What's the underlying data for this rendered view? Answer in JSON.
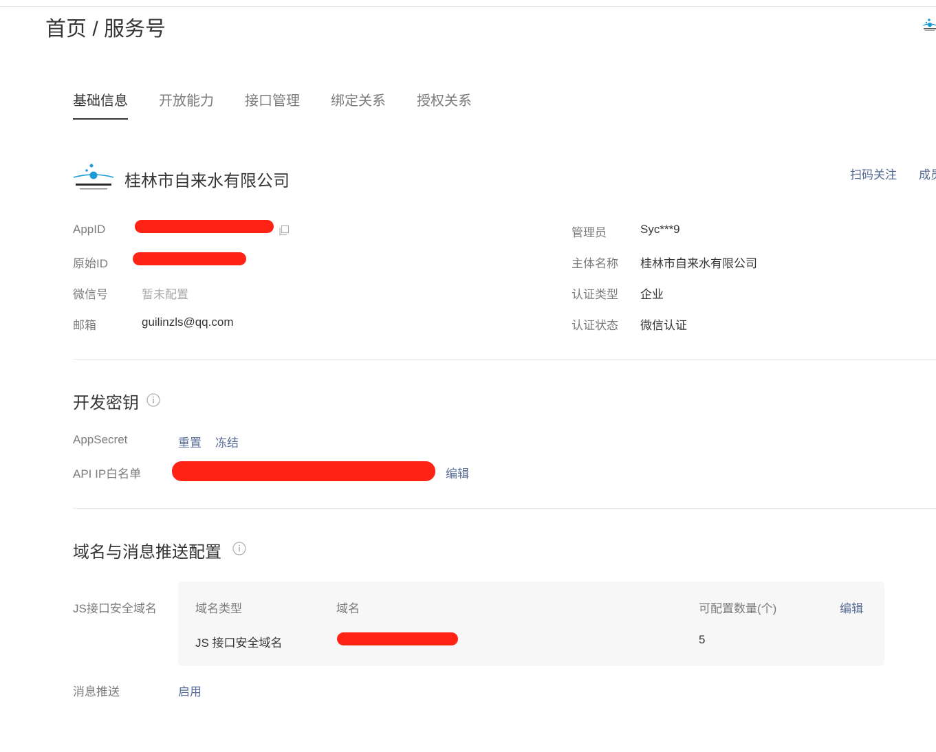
{
  "breadcrumb": {
    "home": "首页",
    "sep": "/",
    "current": "服务号"
  },
  "tabs": [
    {
      "label": "基础信息",
      "active": true
    },
    {
      "label": "开放能力",
      "active": false
    },
    {
      "label": "接口管理",
      "active": false
    },
    {
      "label": "绑定关系",
      "active": false
    },
    {
      "label": "授权关系",
      "active": false
    }
  ],
  "account": {
    "name": "桂林市自来水有限公司",
    "logo_icon": "water-company-logo",
    "scan_follow": "扫码关注",
    "member_partial": "成员"
  },
  "info_left": [
    {
      "label": "AppID",
      "value": "",
      "redacted": true
    },
    {
      "label": "原始ID",
      "value": "",
      "redacted": true
    },
    {
      "label": "微信号",
      "value": "暂未配置",
      "muted": true
    },
    {
      "label": "邮箱",
      "value": "guilinzls@qq.com"
    }
  ],
  "info_right": [
    {
      "label": "管理员",
      "value": "Syc***9"
    },
    {
      "label": "主体名称",
      "value": "桂林市自来水有限公司"
    },
    {
      "label": "认证类型",
      "value": "企业"
    },
    {
      "label": "认证状态",
      "value": "微信认证"
    }
  ],
  "dev_key": {
    "title": "开发密钥",
    "appsecret_label": "AppSecret",
    "reset": "重置",
    "freeze": "冻结",
    "ip_label": "API IP白名单",
    "ip_edit": "编辑"
  },
  "domain": {
    "title": "域名与消息推送配置",
    "js_label": "JS接口安全域名",
    "columns": [
      "域名类型",
      "域名",
      "可配置数量(个)"
    ],
    "edit": "编辑",
    "rows": [
      {
        "type": "JS 接口安全域名",
        "domain": "",
        "count": "5"
      }
    ],
    "push_label": "消息推送",
    "push_action": "启用"
  },
  "colors": {
    "link": "#576b95",
    "redaction": "#ff2316",
    "text": "#353535",
    "label": "#7b7b7b"
  }
}
